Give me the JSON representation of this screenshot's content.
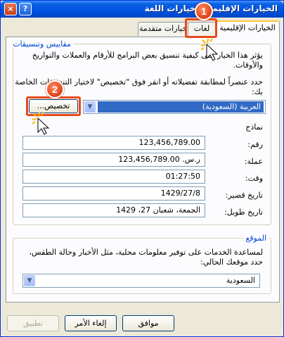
{
  "window": {
    "title": "الخيارات الإقليمية وخيارات اللغة",
    "help_label": "?",
    "close_label": "×"
  },
  "tabs": [
    {
      "label": "الخيارات الإقليمية",
      "selected": true
    },
    {
      "label": "لغات",
      "selected": false
    },
    {
      "label": "خيارات متقدمة",
      "selected": false
    }
  ],
  "standards": {
    "legend": "مقاييس وتنسيقات",
    "description": "يؤثر هذا الخيار على كيفية تنسيق بعض البرامج للأرقام والعملات والتواريخ والأوقات.",
    "instruction": "حدد عنصراً لمطابقة تفضيلاته أو انقر فوق \"تخصيص\" لاختيار التنسيقات الخاصة بك:",
    "selected_locale": "العربية (السعودية)",
    "customize_label": "تخصيص...",
    "samples_heading": "نماذج",
    "samples": [
      {
        "label": "رقم:",
        "value": "123,456,789.00"
      },
      {
        "label": "عملة:",
        "value": "ر.س.‏ 123,456,789.00"
      },
      {
        "label": "وقت:",
        "value": "01:27:50"
      },
      {
        "label": "تاريخ قصير:",
        "value": "1429/27/8"
      },
      {
        "label": "تاريخ طويل:",
        "value": "الجمعة، شعبان 27، 1429"
      }
    ]
  },
  "location": {
    "legend": "الموقع",
    "description": "لمساعدة الخدمات على توفير معلومات محلية، مثل الأخبار وحالة الطقس، حدد موقعك الحالي:",
    "selected": "السعودية"
  },
  "buttons": {
    "ok": "موافق",
    "cancel": "إلغاء الأمر",
    "apply": "تطبيق"
  },
  "annotations": {
    "step1": "1",
    "step2": "2"
  },
  "colors": {
    "highlight": "#e84a1c",
    "selection": "#316ac5",
    "titlebar": "#0054e3"
  }
}
